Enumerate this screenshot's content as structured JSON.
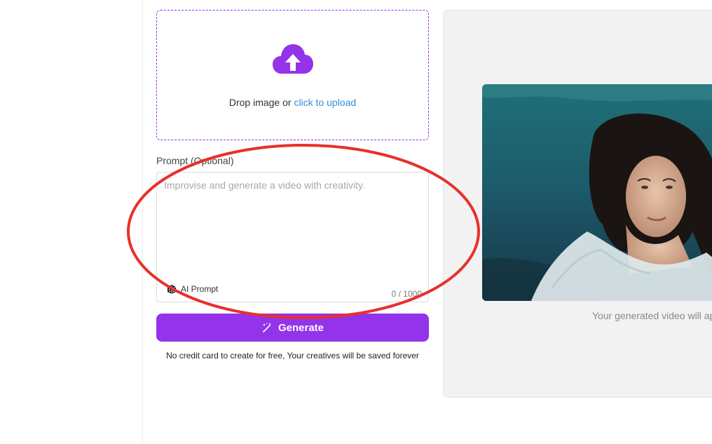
{
  "upload": {
    "text_prefix": "Drop image or",
    "link_text": "click to upload",
    "icon": "cloud-upload-icon"
  },
  "prompt": {
    "label": "Prompt (Optional)",
    "placeholder": "Improvise and generate a video with creativity.",
    "value": "",
    "ai_prompt_label": "AI Prompt",
    "ai_prompt_icon": "dice-icon",
    "counter": "0 / 1000"
  },
  "generate": {
    "label": "Generate",
    "icon": "magic-wand-icon"
  },
  "footnote": "No credit card to create for free, Your creatives will be saved forever",
  "preview": {
    "caption": "Your generated video will ap"
  },
  "colors": {
    "accent": "#9333ea",
    "link": "#2f8fe0",
    "annotation": "#e8302a"
  }
}
